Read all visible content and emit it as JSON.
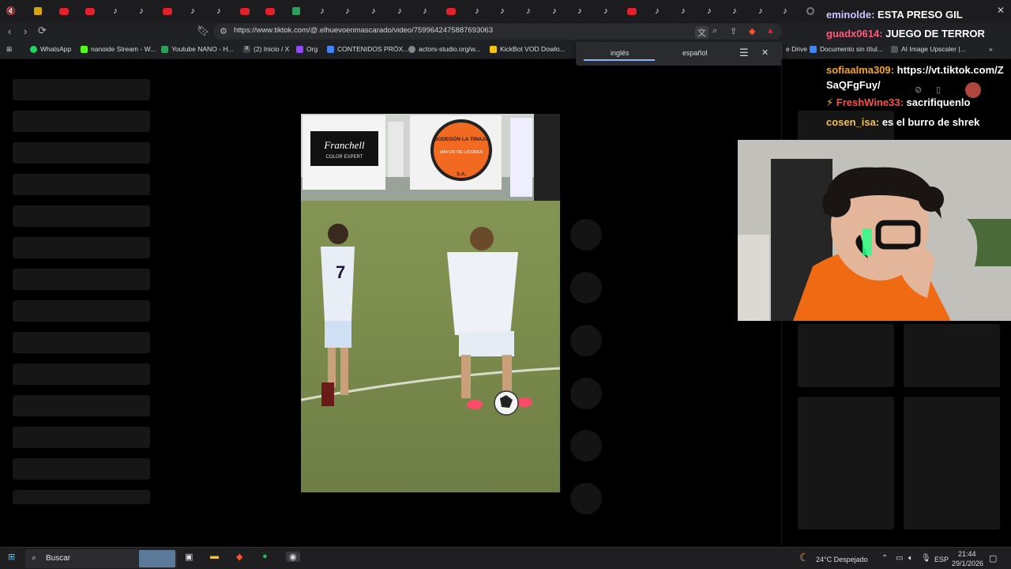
{
  "browser": {
    "url": "https://www.tiktok.com/@.elhuevoenmascarado/video/7599642475887693063",
    "bookmarks": [
      "WhatsApp",
      "nanoide Stream - W...",
      "Youtube NANO - H...",
      "(2) Inicio / X",
      "Org",
      "CONTENIDOS PRÓX...",
      "actors-studio.org/w...",
      "KickBot VOD Dowlo..."
    ],
    "bookmarks_right": [
      "e Drive",
      "Documento sin títul...",
      "AI Image Upscaler |..."
    ],
    "translate": {
      "source_lang": "inglés",
      "target_lang": "español"
    },
    "colors": {
      "tab_youtube": "#e3202d",
      "accent": "#8ab4f8"
    }
  },
  "chat": [
    {
      "user": "eminolde",
      "message": "ESTA PRESO GIL",
      "color": "#c8c8ff"
    },
    {
      "user": "guadx0614",
      "message": "JUEGO DE TERROR",
      "color": "#ff5a7a"
    },
    {
      "user": "sofiaalma309",
      "message": "https://vt.tiktok.com/ZSaQFgFuy/",
      "color": "#f5a623"
    },
    {
      "user": "FreshWine33",
      "message": "sacrifiquenlo",
      "color": "#ff4d4d"
    },
    {
      "user": "cosen_isa",
      "message": "es el burro de shrek",
      "color": "#f2c14e"
    }
  ],
  "video": {
    "banner_left_brand": "Franchell",
    "banner_left_tag": "COLOR EXPERT",
    "banner_right_line1": "BODEGÓN LA TINAJA",
    "banner_right_line2": "MAYOR DE LICORES",
    "banner_right_line3": "S.A.",
    "player_number": "7"
  },
  "taskbar": {
    "search_placeholder": "Buscar",
    "weather": "24°C  Despejado",
    "lang": "ESP",
    "time": "21:44",
    "date": "29/1/2026"
  }
}
